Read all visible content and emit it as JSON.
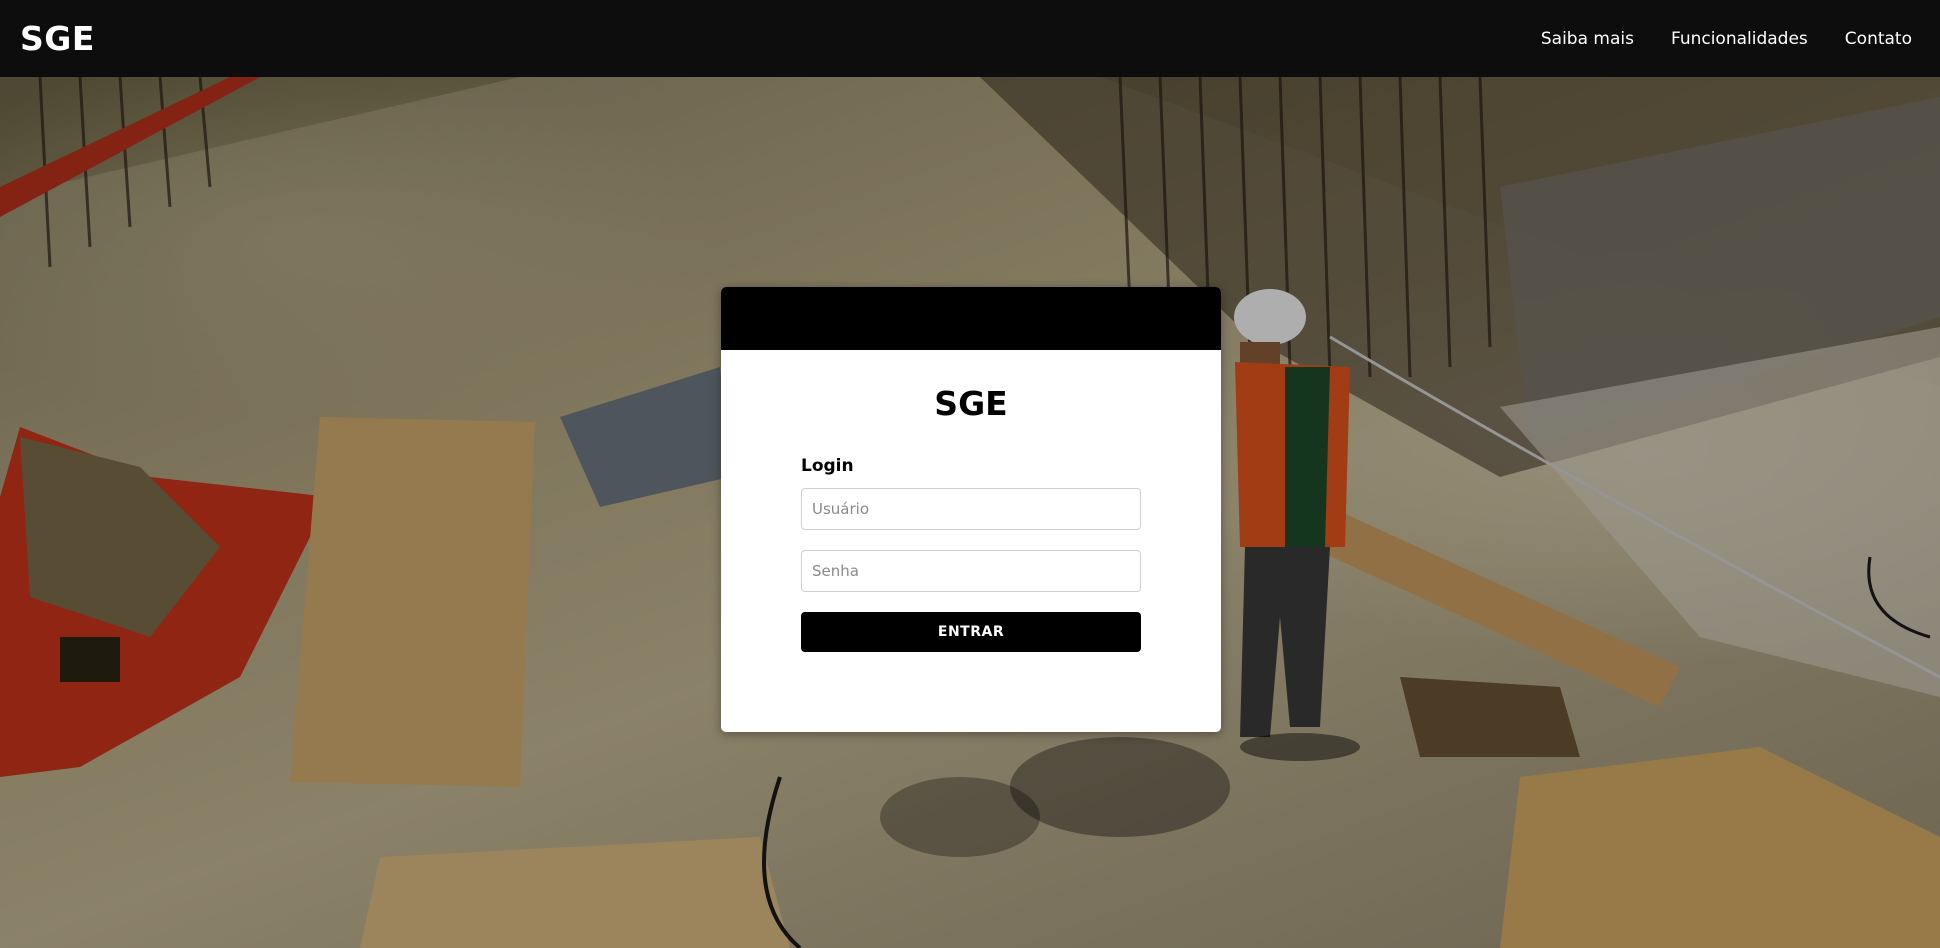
{
  "navbar": {
    "brand": "SGE",
    "links": [
      {
        "label": "Saiba mais"
      },
      {
        "label": "Funcionalidades"
      },
      {
        "label": "Contato"
      }
    ]
  },
  "background": {
    "subject": "construction site photo with worker in hard hat"
  },
  "login": {
    "title": "SGE",
    "label": "Login",
    "username_placeholder": "Usuário",
    "password_placeholder": "Senha",
    "submit_label": "ENTRAR"
  },
  "colors": {
    "navbar_bg": "#0d0d0d",
    "card_header": "#000000",
    "button_bg": "#000000",
    "card_bg": "#ffffff"
  }
}
